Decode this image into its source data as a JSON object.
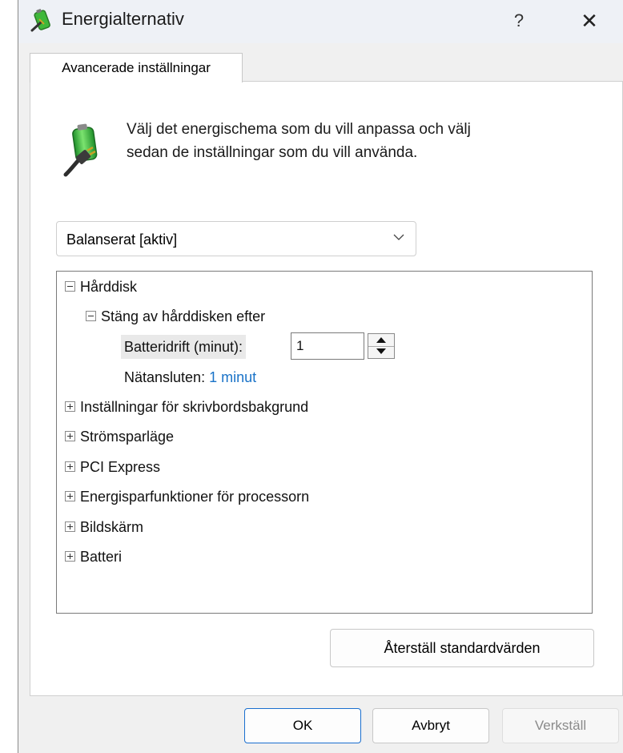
{
  "window": {
    "title": "Energialternativ",
    "help_label": "?",
    "close_label": "✕"
  },
  "tab": {
    "label": "Avancerade inställningar"
  },
  "intro": {
    "line1": "Välj det energischema som du vill anpassa och välj",
    "line2": "sedan de inställningar som du vill använda."
  },
  "plan_select": {
    "selected": "Balanserat [aktiv]"
  },
  "tree": {
    "harddisk": {
      "label": "Hårddisk",
      "expanded": true
    },
    "turn_off": {
      "label": "Stäng av hårddisken efter",
      "expanded": true
    },
    "battery": {
      "label": "Batteridrift (minut):",
      "value": "1"
    },
    "plugged": {
      "label": "Nätansluten:",
      "value": "1 minut"
    },
    "items": [
      {
        "label": "Inställningar för skrivbordsbakgrund",
        "expanded": false
      },
      {
        "label": "Strömsparläge",
        "expanded": false
      },
      {
        "label": "PCI Express",
        "expanded": false
      },
      {
        "label": "Energisparfunktioner för processorn",
        "expanded": false
      },
      {
        "label": "Bildskärm",
        "expanded": false
      },
      {
        "label": "Batteri",
        "expanded": false
      }
    ]
  },
  "buttons": {
    "reset": "Återställ standardvärden",
    "ok": "OK",
    "cancel": "Avbryt",
    "apply": "Verkställ"
  },
  "icons": {
    "title": "battery-plug-icon",
    "intro": "battery-plug-icon",
    "dropdown": "chevron-down-icon"
  },
  "colors": {
    "link": "#1a73c8",
    "accent_border": "#1a6fcf",
    "battery_green": "#3fb83a"
  }
}
